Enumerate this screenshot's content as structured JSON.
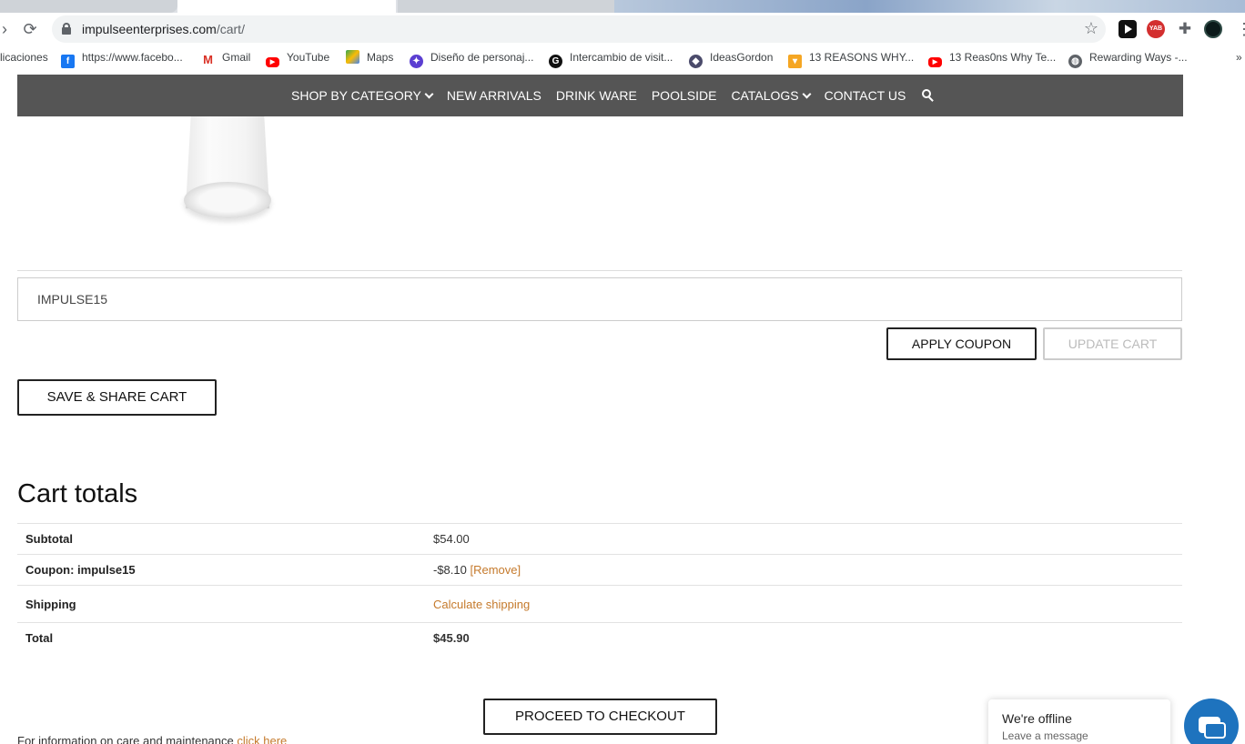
{
  "browser": {
    "url_host": "impulseenterprises.com",
    "url_path": "/cart/",
    "bookmarks": [
      {
        "label": "licaciones",
        "icon": "apps-icon"
      },
      {
        "label": "https://www.facebo...",
        "icon": "facebook-icon"
      },
      {
        "label": "Gmail",
        "icon": "gmail-icon"
      },
      {
        "label": "YouTube",
        "icon": "youtube-icon"
      },
      {
        "label": "Maps",
        "icon": "maps-icon"
      },
      {
        "label": "Diseño de personaj...",
        "icon": "bookmark-icon"
      },
      {
        "label": "Intercambio de visit...",
        "icon": "bookmark-icon"
      },
      {
        "label": "IdeasGordon",
        "icon": "bookmark-icon"
      },
      {
        "label": "13 REASONS WHY...",
        "icon": "bookmark-icon"
      },
      {
        "label": "13 Reas0ns Why Te...",
        "icon": "youtube-icon"
      },
      {
        "label": "Rewarding Ways -...",
        "icon": "globe-icon"
      }
    ],
    "more": "»"
  },
  "nav": {
    "shop_by_category": "SHOP BY CATEGORY",
    "new_arrivals": "NEW ARRIVALS",
    "drink_ware": "DRINK WARE",
    "poolside": "POOLSIDE",
    "catalogs": "CATALOGS",
    "contact_us": "CONTACT US"
  },
  "coupon": {
    "value": "IMPULSE15",
    "apply_label": "APPLY COUPON",
    "update_label": "UPDATE CART"
  },
  "save_share_label": "SAVE & SHARE CART",
  "totals": {
    "title": "Cart totals",
    "subtotal_label": "Subtotal",
    "subtotal_value": "$54.00",
    "coupon_label": "Coupon: impulse15",
    "coupon_value": "-$8.10",
    "remove_label": "[Remove]",
    "shipping_label": "Shipping",
    "shipping_value": "Calculate shipping",
    "total_label": "Total",
    "total_value": "$45.90"
  },
  "checkout_label": "PROCEED TO CHECKOUT",
  "care": {
    "text": "For information on care and maintenance ",
    "link": "click here"
  },
  "chat": {
    "title": "We're offline",
    "subtitle": "Leave a message"
  },
  "colors": {
    "nav_bg": "#555555",
    "link": "#c57a2c",
    "chat_accent": "#1e73be"
  }
}
